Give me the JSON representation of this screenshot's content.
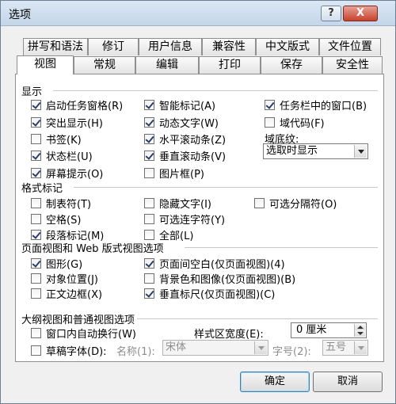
{
  "window": {
    "title": "选项",
    "help_label": "?",
    "close_label": "X"
  },
  "tabs_row1": [
    "拼写和语法",
    "修订",
    "用户信息",
    "兼容性",
    "中文版式",
    "文件位置"
  ],
  "tabs_row2": [
    "视图",
    "常规",
    "编辑",
    "打印",
    "保存",
    "安全性"
  ],
  "active_tab": "视图",
  "sections": {
    "display": "显示",
    "format_marks": "格式标记",
    "page_web": "页面视图和 Web 版式视图选项",
    "outline": "大纲视图和普通视图选项"
  },
  "display": {
    "col1": [
      {
        "label": "启动任务窗格(R)",
        "checked": true
      },
      {
        "label": "突出显示(H)",
        "checked": true
      },
      {
        "label": "书签(K)",
        "checked": false
      },
      {
        "label": "状态栏(U)",
        "checked": true
      },
      {
        "label": "屏幕提示(O)",
        "checked": true
      }
    ],
    "col2": [
      {
        "label": "智能标记(A)",
        "checked": true
      },
      {
        "label": "动态文字(W)",
        "checked": true
      },
      {
        "label": "水平滚动条(Z)",
        "checked": true
      },
      {
        "label": "垂直滚动条(V)",
        "checked": true
      },
      {
        "label": "图片框(P)",
        "checked": false
      }
    ],
    "col3": [
      {
        "label": "任务栏中的窗口(B)",
        "checked": true
      },
      {
        "label": "域代码(F)",
        "checked": false
      }
    ],
    "shading_label": "域底纹:",
    "shading_value": "选取时显示"
  },
  "format_marks": {
    "col1": [
      {
        "label": "制表符(T)",
        "checked": false
      },
      {
        "label": "空格(S)",
        "checked": false
      },
      {
        "label": "段落标记(M)",
        "checked": true
      }
    ],
    "col2": [
      {
        "label": "隐藏文字(I)",
        "checked": false
      },
      {
        "label": "可选连字符(Y)",
        "checked": false
      },
      {
        "label": "全部(L)",
        "checked": false
      }
    ],
    "col3": [
      {
        "label": "可选分隔符(O)",
        "checked": false
      }
    ]
  },
  "page_web": {
    "col1": [
      {
        "label": "图形(G)",
        "checked": true
      },
      {
        "label": "对象位置(J)",
        "checked": false
      },
      {
        "label": "正文边框(X)",
        "checked": false
      }
    ],
    "col2": [
      {
        "label": "页面间空白(仅页面视图)(4)",
        "checked": true
      },
      {
        "label": "背景色和图像(仅页面视图)(B)",
        "checked": false
      },
      {
        "label": "垂直标尺(仅页面视图)(C)",
        "checked": true
      }
    ]
  },
  "outline": {
    "wrap": {
      "label": "窗口内自动换行(W)",
      "checked": false
    },
    "draft": {
      "label": "草稿字体(D):",
      "checked": false
    },
    "style_width_label": "样式区宽度(E):",
    "style_width_value": "0 厘米",
    "name_label": "名称(1):",
    "name_value": "宋体",
    "size_label": "字号(2):",
    "size_value": "五号"
  },
  "buttons": {
    "ok": "确定",
    "cancel": "取消"
  }
}
